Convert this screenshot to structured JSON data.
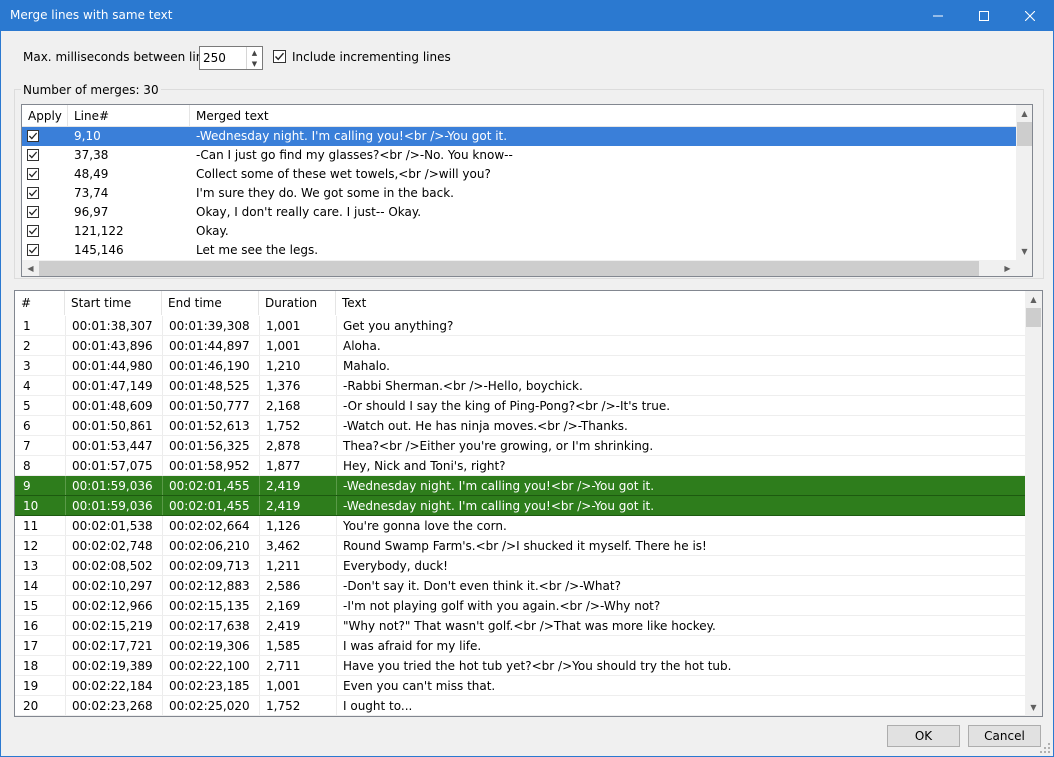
{
  "window": {
    "title": "Merge lines with same text"
  },
  "options": {
    "max_ms_label": "Max. milliseconds between lines",
    "max_ms_value": "250",
    "include_incrementing_label": "Include incrementing lines",
    "include_incrementing_checked": true
  },
  "merges": {
    "count_label": "Number of merges: 30",
    "columns": [
      "Apply",
      "Line#",
      "Merged text"
    ],
    "rows": [
      {
        "apply": true,
        "line": "9,10",
        "text": "-Wednesday night. I'm calling you!<br />-You got it.",
        "selected": true
      },
      {
        "apply": true,
        "line": "37,38",
        "text": "-Can I just go find my glasses?<br />-No. You know--"
      },
      {
        "apply": true,
        "line": "48,49",
        "text": "Collect some of these wet towels,<br />will you?"
      },
      {
        "apply": true,
        "line": "73,74",
        "text": "I'm sure they do. We got some in the back."
      },
      {
        "apply": true,
        "line": "96,97",
        "text": "Okay, I don't really care. I just-- Okay."
      },
      {
        "apply": true,
        "line": "121,122",
        "text": "Okay."
      },
      {
        "apply": true,
        "line": "145,146",
        "text": "Let me see the legs."
      }
    ]
  },
  "subtitles": {
    "columns": [
      "#",
      "Start time",
      "End time",
      "Duration",
      "Text"
    ],
    "rows": [
      {
        "n": "1",
        "start": "00:01:38,307",
        "end": "00:01:39,308",
        "dur": "1,001",
        "text": "Get you anything?"
      },
      {
        "n": "2",
        "start": "00:01:43,896",
        "end": "00:01:44,897",
        "dur": "1,001",
        "text": "Aloha."
      },
      {
        "n": "3",
        "start": "00:01:44,980",
        "end": "00:01:46,190",
        "dur": "1,210",
        "text": "Mahalo."
      },
      {
        "n": "4",
        "start": "00:01:47,149",
        "end": "00:01:48,525",
        "dur": "1,376",
        "text": "-Rabbi Sherman.<br />-Hello, boychick."
      },
      {
        "n": "5",
        "start": "00:01:48,609",
        "end": "00:01:50,777",
        "dur": "2,168",
        "text": "-Or should I say the king of Ping-Pong?<br />-It's true."
      },
      {
        "n": "6",
        "start": "00:01:50,861",
        "end": "00:01:52,613",
        "dur": "1,752",
        "text": "-Watch out. He has ninja moves.<br />-Thanks."
      },
      {
        "n": "7",
        "start": "00:01:53,447",
        "end": "00:01:56,325",
        "dur": "2,878",
        "text": "Thea?<br />Either you're growing, or I'm shrinking."
      },
      {
        "n": "8",
        "start": "00:01:57,075",
        "end": "00:01:58,952",
        "dur": "1,877",
        "text": "Hey, Nick and Toni's, right?"
      },
      {
        "n": "9",
        "start": "00:01:59,036",
        "end": "00:02:01,455",
        "dur": "2,419",
        "text": "-Wednesday night. I'm calling you!<br />-You got it.",
        "highlight": true
      },
      {
        "n": "10",
        "start": "00:01:59,036",
        "end": "00:02:01,455",
        "dur": "2,419",
        "text": "-Wednesday night. I'm calling you!<br />-You got it.",
        "highlight": true
      },
      {
        "n": "11",
        "start": "00:02:01,538",
        "end": "00:02:02,664",
        "dur": "1,126",
        "text": "You're gonna love the corn."
      },
      {
        "n": "12",
        "start": "00:02:02,748",
        "end": "00:02:06,210",
        "dur": "3,462",
        "text": "Round Swamp Farm's.<br />I shucked it myself. There he is!"
      },
      {
        "n": "13",
        "start": "00:02:08,502",
        "end": "00:02:09,713",
        "dur": "1,211",
        "text": "Everybody, duck!"
      },
      {
        "n": "14",
        "start": "00:02:10,297",
        "end": "00:02:12,883",
        "dur": "2,586",
        "text": "-Don't say it. Don't even think it.<br />-What?"
      },
      {
        "n": "15",
        "start": "00:02:12,966",
        "end": "00:02:15,135",
        "dur": "2,169",
        "text": "-I'm not playing golf with you again.<br />-Why not?"
      },
      {
        "n": "16",
        "start": "00:02:15,219",
        "end": "00:02:17,638",
        "dur": "2,419",
        "text": "\"Why not?\" That wasn't golf.<br />That was more like hockey."
      },
      {
        "n": "17",
        "start": "00:02:17,721",
        "end": "00:02:19,306",
        "dur": "1,585",
        "text": "I was afraid for my life."
      },
      {
        "n": "18",
        "start": "00:02:19,389",
        "end": "00:02:22,100",
        "dur": "2,711",
        "text": "Have you tried the hot tub yet?<br />You should try the hot tub."
      },
      {
        "n": "19",
        "start": "00:02:22,184",
        "end": "00:02:23,185",
        "dur": "1,001",
        "text": "Even you can't miss that."
      },
      {
        "n": "20",
        "start": "00:02:23,268",
        "end": "00:02:25,020",
        "dur": "1,752",
        "text": "I ought to..."
      }
    ]
  },
  "buttons": {
    "ok": "OK",
    "cancel": "Cancel"
  },
  "colors": {
    "titlebar": "#2b79d0",
    "selection": "#3a7fd9",
    "highlight": "#2e7d1c"
  }
}
